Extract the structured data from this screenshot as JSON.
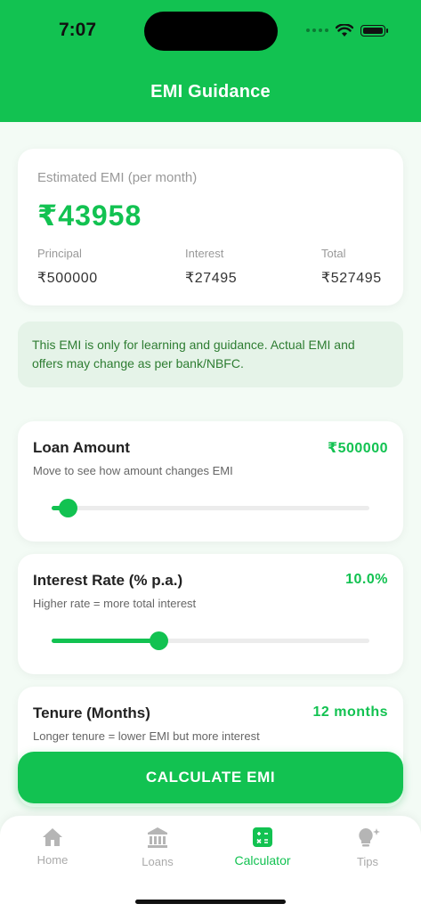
{
  "status": {
    "time": "7:07"
  },
  "header": {
    "title": "EMI Guidance"
  },
  "summary": {
    "label": "Estimated EMI (per month)",
    "emi": "₹43958",
    "principal_label": "Principal",
    "principal": "₹500000",
    "interest_label": "Interest",
    "interest": "₹27495",
    "total_label": "Total",
    "total": "₹527495"
  },
  "note": "This EMI is only for learning and guidance. Actual EMI and offers may change as per bank/NBFC.",
  "sliders": [
    {
      "title": "Loan Amount",
      "value": "₹500000",
      "help": "Move to see how amount changes EMI",
      "level": 0.05
    },
    {
      "title": "Interest Rate (% p.a.)",
      "value": "10.0%",
      "help": "Higher rate = more total interest",
      "level": 0.335
    },
    {
      "title": "Tenure (Months)",
      "value": "12 months",
      "help": "Longer tenure = lower EMI but more interest"
    }
  ],
  "button": {
    "label": "CALCULATE EMI"
  },
  "tabs": [
    {
      "label": "Home",
      "icon": "home-icon"
    },
    {
      "label": "Loans",
      "icon": "bank-icon"
    },
    {
      "label": "Calculator",
      "icon": "calculator-icon",
      "active": true
    },
    {
      "label": "Tips",
      "icon": "lightbulb-icon"
    }
  ],
  "colors": {
    "accent": "#12c251",
    "note_bg": "#e5f3e8",
    "note_text": "#2e7d32"
  }
}
